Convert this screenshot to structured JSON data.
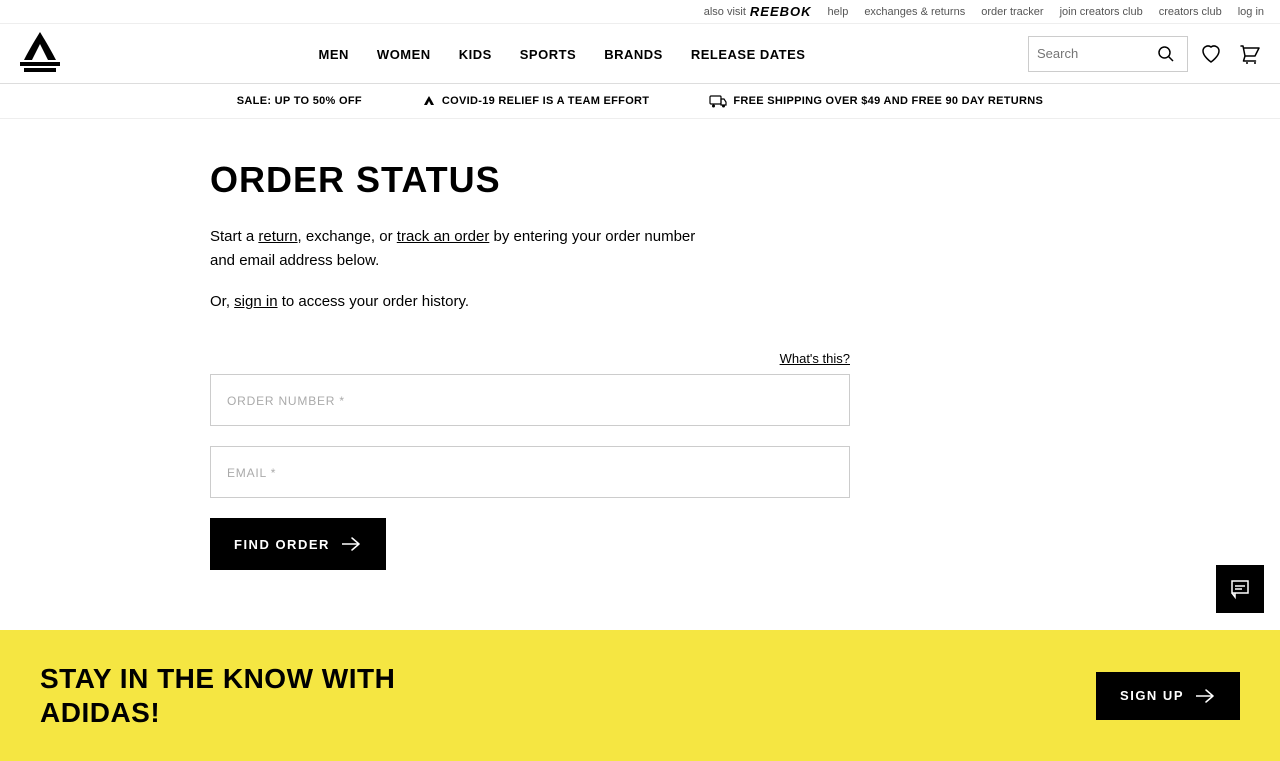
{
  "utility_bar": {
    "also_visit_label": "also visit",
    "reebok_label": "Reebok",
    "links": [
      {
        "id": "help",
        "label": "help"
      },
      {
        "id": "exchanges",
        "label": "exchanges & returns"
      },
      {
        "id": "order-tracker",
        "label": "order tracker"
      },
      {
        "id": "join-creators",
        "label": "join creators club"
      },
      {
        "id": "creators-club",
        "label": "creators club"
      },
      {
        "id": "log-in",
        "label": "log in"
      }
    ]
  },
  "nav": {
    "items": [
      {
        "id": "men",
        "label": "MEN"
      },
      {
        "id": "women",
        "label": "WOMEN"
      },
      {
        "id": "kids",
        "label": "KIDS"
      },
      {
        "id": "sports",
        "label": "SPORTS"
      },
      {
        "id": "brands",
        "label": "BRANDS"
      },
      {
        "id": "release-dates",
        "label": "RELEASE DATES"
      }
    ],
    "search_placeholder": "Search"
  },
  "promo_bar": {
    "items": [
      {
        "id": "sale",
        "label": "SALE: UP TO 50% OFF"
      },
      {
        "id": "covid",
        "label": "COVID-19 RELIEF IS A TEAM EFFORT"
      },
      {
        "id": "shipping",
        "label": "FREE SHIPPING OVER $49 AND FREE 90 DAY RETURNS"
      }
    ]
  },
  "page": {
    "title": "ORDER STATUS",
    "description_part1": "Start a ",
    "return_link": "return",
    "description_part2": ", exchange, or ",
    "track_link": "track an order",
    "description_part3": " by entering your order number and email address below.",
    "sign_in_prefix": "Or, ",
    "sign_in_link": "sign in",
    "sign_in_suffix": " to access your order history.",
    "what_this_link": "What's this?",
    "order_number_placeholder": "ORDER NUMBER *",
    "email_placeholder": "EMAIL *",
    "find_order_btn": "FIND ORDER"
  },
  "footer": {
    "signup_text_line1": "STAY IN THE KNOW WITH",
    "signup_text_line2": "ADIDAS!",
    "signup_btn": "SIGN UP"
  },
  "colors": {
    "yellow": "#f5e642",
    "black": "#000000",
    "white": "#ffffff"
  }
}
